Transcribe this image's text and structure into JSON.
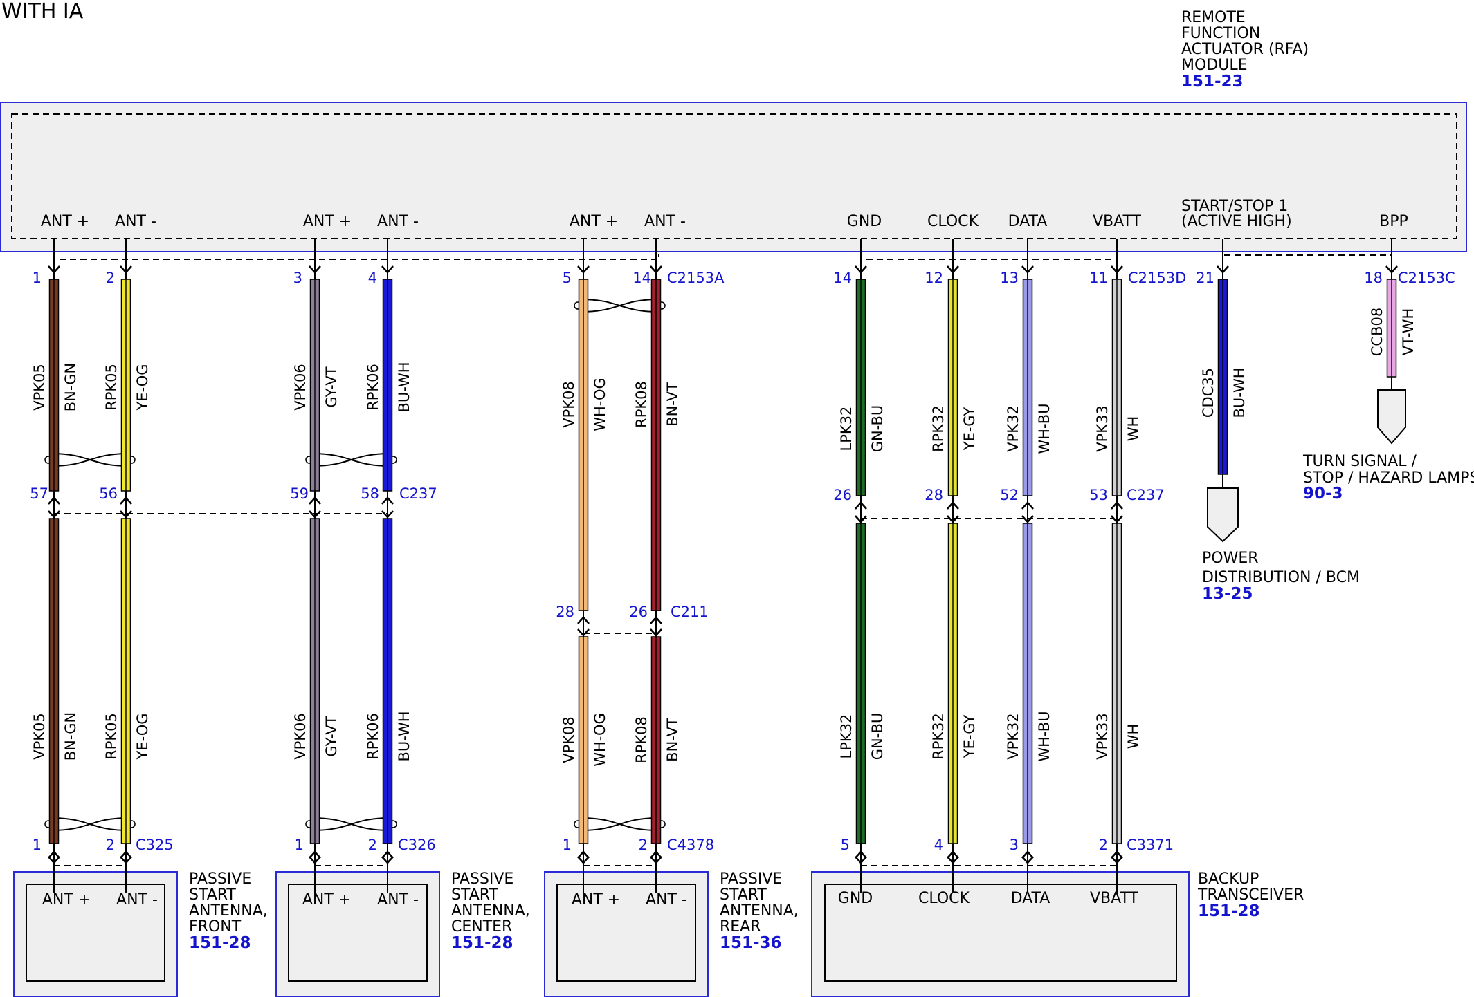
{
  "title": "WITH IA",
  "colors": {
    "box_stroke": "#2b2bd6",
    "box_fill": "#efefef",
    "pin_text": "#1414cc",
    "BN-GN": "#7a3b22",
    "YE-OG": "#f2e82a",
    "GY-VT": "#8c7f97",
    "BU-WH": "#1a1ad6",
    "WH-OG": "#f2b877",
    "BN-VT": "#a52330",
    "GN-BU": "#1f6d24",
    "YE-GY": "#e3e534",
    "WH-BU": "#9a9ae9",
    "WH": "#d2d2d2",
    "VT-WH": "#e7a7e5"
  },
  "rfa_module": {
    "lines": [
      "REMOTE",
      "FUNCTION",
      "ACTUATOR (RFA)",
      "MODULE"
    ],
    "ref": "151-23",
    "terminals": [
      "ANT +",
      "ANT -",
      "ANT +",
      "ANT -",
      "ANT +",
      "ANT -",
      "GND",
      "CLOCK",
      "DATA",
      "VBATT",
      "START/STOP 1",
      "(ACTIVE HIGH)",
      "BPP"
    ]
  },
  "connectors": {
    "c2153a": "C2153A",
    "c2153d": "C2153D",
    "c2153c": "C2153C",
    "c237_a": "C237",
    "c237_b": "C237",
    "c211": "C211",
    "c325": "C325",
    "c326": "C326",
    "c4378": "C4378",
    "c3371": "C3371"
  },
  "wires": [
    {
      "circuit": "VPK05",
      "color_code": "BN-GN",
      "top_pin": "1",
      "mid_pin": "57",
      "bot_pin": "1"
    },
    {
      "circuit": "RPK05",
      "color_code": "YE-OG",
      "top_pin": "2",
      "mid_pin": "56",
      "bot_pin": "2"
    },
    {
      "circuit": "VPK06",
      "color_code": "GY-VT",
      "top_pin": "3",
      "mid_pin": "59",
      "bot_pin": "1"
    },
    {
      "circuit": "RPK06",
      "color_code": "BU-WH",
      "top_pin": "4",
      "mid_pin": "58",
      "bot_pin": "2"
    },
    {
      "circuit": "VPK08",
      "color_code": "WH-OG",
      "top_pin": "5",
      "mid_pin": "28",
      "bot_pin": "1"
    },
    {
      "circuit": "RPK08",
      "color_code": "BN-VT",
      "top_pin": "14",
      "mid_pin": "26",
      "bot_pin": "2"
    },
    {
      "circuit": "LPK32",
      "color_code": "GN-BU",
      "top_pin": "14",
      "mid_pin": "26",
      "bot_pin": "5"
    },
    {
      "circuit": "RPK32",
      "color_code": "YE-GY",
      "top_pin": "12",
      "mid_pin": "28",
      "bot_pin": "4"
    },
    {
      "circuit": "VPK32",
      "color_code": "WH-BU",
      "top_pin": "13",
      "mid_pin": "52",
      "bot_pin": "3"
    },
    {
      "circuit": "VPK33",
      "color_code": "WH",
      "top_pin": "11",
      "mid_pin": "53",
      "bot_pin": "2"
    },
    {
      "circuit": "CDC35",
      "color_code": "BU-WH",
      "top_pin": "21"
    },
    {
      "circuit": "CCB08",
      "color_code": "VT-WH",
      "top_pin": "18"
    }
  ],
  "destinations": {
    "power_dist": {
      "lines": [
        "POWER",
        "DISTRIBUTION / BCM"
      ],
      "ref": "13-25"
    },
    "turn_signal": {
      "lines": [
        "TURN SIGNAL /",
        "STOP / HAZARD LAMPS"
      ],
      "ref": "90-3"
    }
  },
  "components": {
    "front": {
      "lines": [
        "PASSIVE",
        "START",
        "ANTENNA,",
        "FRONT"
      ],
      "ref": "151-28",
      "terminals": [
        "ANT +",
        "ANT -"
      ]
    },
    "center": {
      "lines": [
        "PASSIVE",
        "START",
        "ANTENNA,",
        "CENTER"
      ],
      "ref": "151-28",
      "terminals": [
        "ANT +",
        "ANT -"
      ]
    },
    "rear": {
      "lines": [
        "PASSIVE",
        "START",
        "ANTENNA,",
        "REAR"
      ],
      "ref": "151-36",
      "terminals": [
        "ANT +",
        "ANT -"
      ]
    },
    "backup": {
      "lines": [
        "BACKUP",
        "TRANSCEIVER"
      ],
      "ref": "151-28",
      "terminals": [
        "GND",
        "CLOCK",
        "DATA",
        "VBATT"
      ]
    }
  }
}
